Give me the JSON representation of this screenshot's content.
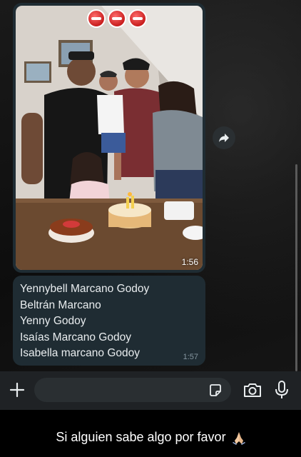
{
  "chat": {
    "photo_message": {
      "time": "1:56",
      "photo_description_icon": "family-photo"
    },
    "text_message": {
      "lines": [
        "Yennybell Marcano Godoy",
        "Beltrán Marcano",
        "Yenny Godoy",
        "Isaías Marcano Godoy",
        "Isabella marcano Godoy"
      ],
      "time": "1:57"
    }
  },
  "input_bar": {
    "placeholder": "",
    "icons": [
      "plus-icon",
      "sticker-icon",
      "camera-icon",
      "microphone-icon"
    ]
  },
  "caption": {
    "text": "Si alguien sabe algo por favor"
  },
  "colors": {
    "bubble": "#1f2c33",
    "bubble_text": "#e9edef",
    "timestamp": "#8696a0",
    "input_bar": "#1f2225"
  }
}
